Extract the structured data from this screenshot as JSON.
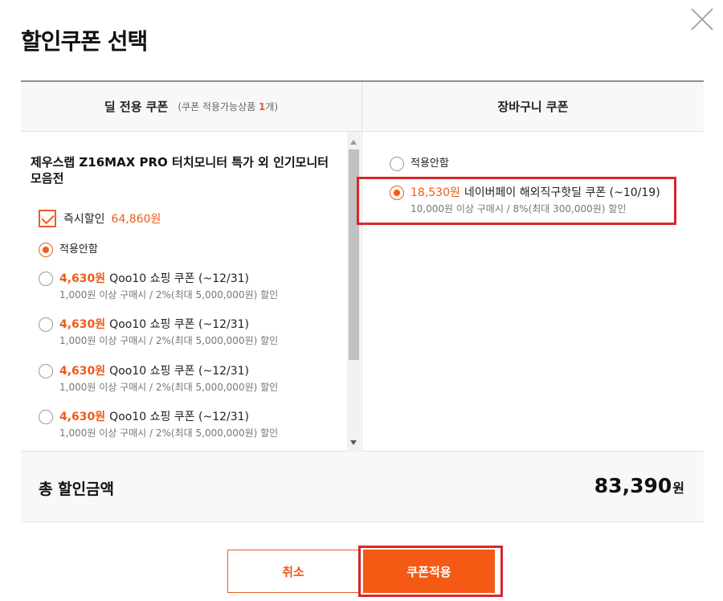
{
  "dialog": {
    "title": "할인쿠폰 선택"
  },
  "deal_column": {
    "heading": "딜 전용 쿠폰",
    "sub_prefix": "(쿠폰 적용가능상품 ",
    "sub_count": "1",
    "sub_suffix": "개)",
    "product_title": "제우스랩 Z16MAX PRO 터치모니터 특가 외 인기모니터 모음전",
    "instant_discount": {
      "label": "즉시할인",
      "amount": "64,860원",
      "checked": true
    },
    "options": [
      {
        "none_label": "적용안함",
        "selected": true
      },
      {
        "amount": "4,630원",
        "name": "Qoo10 쇼핑 쿠폰 (~12/31)",
        "condition": "1,000원 이상 구매시 / 2%(최대 5,000,000원) 할인",
        "selected": false
      },
      {
        "amount": "4,630원",
        "name": "Qoo10 쇼핑 쿠폰 (~12/31)",
        "condition": "1,000원 이상 구매시 / 2%(최대 5,000,000원) 할인",
        "selected": false
      },
      {
        "amount": "4,630원",
        "name": "Qoo10 쇼핑 쿠폰 (~12/31)",
        "condition": "1,000원 이상 구매시 / 2%(최대 5,000,000원) 할인",
        "selected": false
      },
      {
        "amount": "4,630원",
        "name": "Qoo10 쇼핑 쿠폰 (~12/31)",
        "condition": "1,000원 이상 구매시 / 2%(최대 5,000,000원) 할인",
        "selected": false
      }
    ]
  },
  "cart_column": {
    "heading": "장바구니 쿠폰",
    "options": [
      {
        "none_label": "적용안함",
        "selected": false
      },
      {
        "amount": "18,530원",
        "name": "네이버페이 해외직구핫딜 쿠폰 (~10/19)",
        "condition": "10,000원 이상 구매시 / 8%(최대 300,000원) 할인",
        "selected": true
      }
    ]
  },
  "summary": {
    "label": "총 할인금액",
    "value": "83,390",
    "unit": "원"
  },
  "buttons": {
    "cancel_label": "취소",
    "apply_label": "쿠폰적용"
  },
  "colors": {
    "accent": "#f05a1a",
    "highlight_border": "#d9262b"
  },
  "icons": {
    "close": "close-icon"
  }
}
